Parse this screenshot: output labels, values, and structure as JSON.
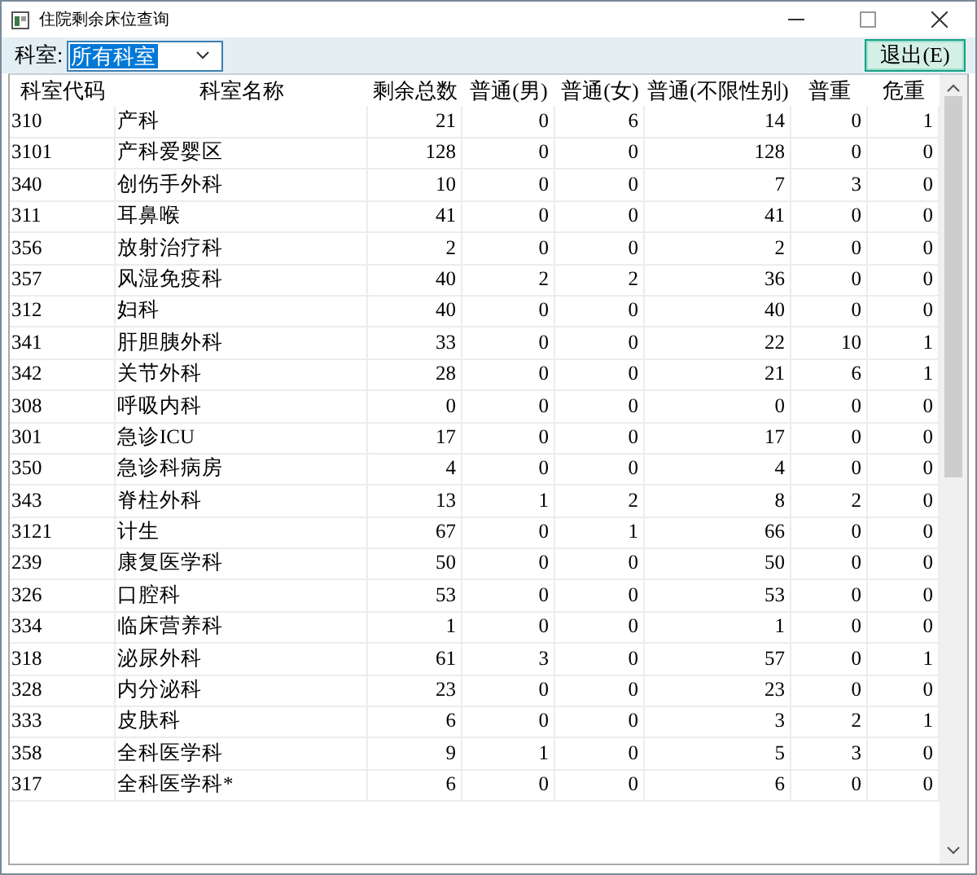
{
  "window": {
    "title": "住院剩余床位查询"
  },
  "filter": {
    "label": "科室:",
    "value": "所有科室"
  },
  "exit_button": {
    "label": "退出(E)"
  },
  "table": {
    "columns": [
      "科室代码",
      "科室名称",
      "剩余总数",
      "普通(男)",
      "普通(女)",
      "普通(不限性别)",
      "普重",
      "危重"
    ],
    "rows": [
      [
        "310",
        "产科",
        "21",
        "0",
        "6",
        "14",
        "0",
        "1"
      ],
      [
        "3101",
        "产科爱婴区",
        "128",
        "0",
        "0",
        "128",
        "0",
        "0"
      ],
      [
        "340",
        "创伤手外科",
        "10",
        "0",
        "0",
        "7",
        "3",
        "0"
      ],
      [
        "311",
        "耳鼻喉",
        "41",
        "0",
        "0",
        "41",
        "0",
        "0"
      ],
      [
        "356",
        "放射治疗科",
        "2",
        "0",
        "0",
        "2",
        "0",
        "0"
      ],
      [
        "357",
        "风湿免疫科",
        "40",
        "2",
        "2",
        "36",
        "0",
        "0"
      ],
      [
        "312",
        "妇科",
        "40",
        "0",
        "0",
        "40",
        "0",
        "0"
      ],
      [
        "341",
        "肝胆胰外科",
        "33",
        "0",
        "0",
        "22",
        "10",
        "1"
      ],
      [
        "342",
        "关节外科",
        "28",
        "0",
        "0",
        "21",
        "6",
        "1"
      ],
      [
        "308",
        "呼吸内科",
        "0",
        "0",
        "0",
        "0",
        "0",
        "0"
      ],
      [
        "301",
        "急诊ICU",
        "17",
        "0",
        "0",
        "17",
        "0",
        "0"
      ],
      [
        "350",
        "急诊科病房",
        "4",
        "0",
        "0",
        "4",
        "0",
        "0"
      ],
      [
        "343",
        "脊柱外科",
        "13",
        "1",
        "2",
        "8",
        "2",
        "0"
      ],
      [
        "3121",
        "计生",
        "67",
        "0",
        "1",
        "66",
        "0",
        "0"
      ],
      [
        "239",
        "康复医学科",
        "50",
        "0",
        "0",
        "50",
        "0",
        "0"
      ],
      [
        "326",
        "口腔科",
        "53",
        "0",
        "0",
        "53",
        "0",
        "0"
      ],
      [
        "334",
        "临床营养科",
        "1",
        "0",
        "0",
        "1",
        "0",
        "0"
      ],
      [
        "318",
        "泌尿外科",
        "61",
        "3",
        "0",
        "57",
        "0",
        "1"
      ],
      [
        "328",
        "内分泌科",
        "23",
        "0",
        "0",
        "23",
        "0",
        "0"
      ],
      [
        "333",
        "皮肤科",
        "6",
        "0",
        "0",
        "3",
        "2",
        "1"
      ],
      [
        "358",
        "全科医学科",
        "9",
        "1",
        "0",
        "5",
        "3",
        "0"
      ],
      [
        "317",
        "全科医学科*",
        "6",
        "0",
        "0",
        "6",
        "0",
        "0"
      ]
    ]
  }
}
